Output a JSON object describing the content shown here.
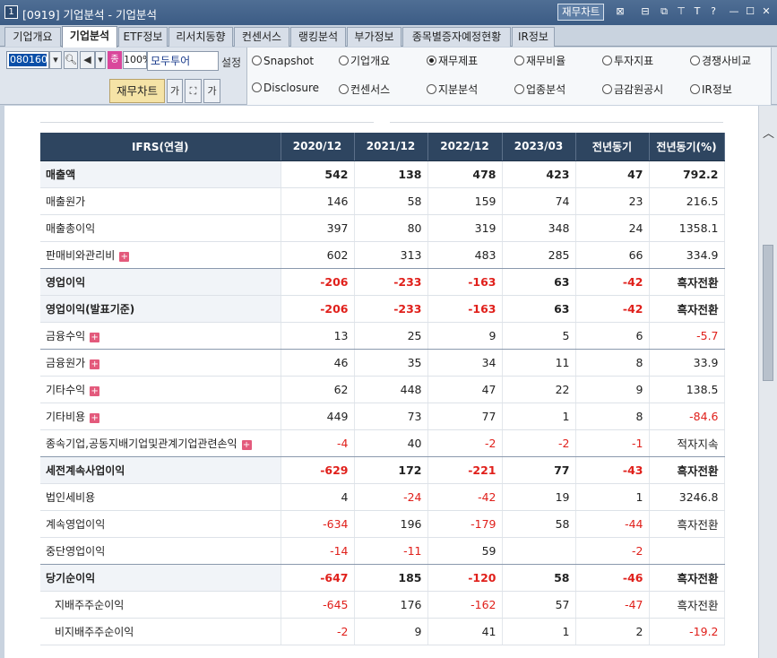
{
  "window": {
    "number": "1",
    "title": "[0919] 기업분석 - 기업분석",
    "chart_button": "재무차트"
  },
  "tabs": [
    {
      "label": "기업개요"
    },
    {
      "label": "기업분석"
    },
    {
      "label": "ETF정보"
    },
    {
      "label": "리서치동향"
    },
    {
      "label": "컨센서스"
    },
    {
      "label": "랭킹분석"
    },
    {
      "label": "부가정보"
    },
    {
      "label": "종목별증자예정현황"
    },
    {
      "label": "IR정보"
    }
  ],
  "toolbar": {
    "code": "080160",
    "zoom": "100%",
    "stock_name": "모두투어",
    "setting_label": "설정",
    "pink_label": "종",
    "fin_chart": "재무차트",
    "font_up": "가",
    "font_down": "가"
  },
  "radio_options": [
    {
      "label": "Snapshot",
      "checked": false
    },
    {
      "label": "기업개요",
      "checked": false
    },
    {
      "label": "재무제표",
      "checked": true
    },
    {
      "label": "재무비율",
      "checked": false
    },
    {
      "label": "투자지표",
      "checked": false
    },
    {
      "label": "경쟁사비교",
      "checked": false
    },
    {
      "label": "Disclosure",
      "checked": false
    },
    {
      "label": "컨센서스",
      "checked": false
    },
    {
      "label": "지분분석",
      "checked": false
    },
    {
      "label": "업종분석",
      "checked": false
    },
    {
      "label": "금감원공시",
      "checked": false
    },
    {
      "label": "IR정보",
      "checked": false
    }
  ],
  "table": {
    "headers": [
      "IFRS(연결)",
      "2020/12",
      "2021/12",
      "2022/12",
      "2023/03",
      "전년동기",
      "전년동기(%)"
    ],
    "rows": [
      {
        "label": "매출액",
        "values": [
          "542",
          "138",
          "478",
          "423",
          "47",
          "792.2"
        ],
        "bold": true,
        "hl": true
      },
      {
        "label": "매출원가",
        "values": [
          "146",
          "58",
          "159",
          "74",
          "23",
          "216.5"
        ]
      },
      {
        "label": "매출총이익",
        "values": [
          "397",
          "80",
          "319",
          "348",
          "24",
          "1358.1"
        ]
      },
      {
        "label": "판매비와관리비",
        "values": [
          "602",
          "313",
          "483",
          "285",
          "66",
          "334.9"
        ],
        "plus": true,
        "sep": true
      },
      {
        "label": "영업이익",
        "values": [
          "-206",
          "-233",
          "-163",
          "63",
          "-42",
          "흑자전환"
        ],
        "bold": true,
        "hl": true
      },
      {
        "label": "영업이익(발표기준)",
        "values": [
          "-206",
          "-233",
          "-163",
          "63",
          "-42",
          "흑자전환"
        ],
        "bold": true,
        "hl": true
      },
      {
        "label": "금융수익",
        "values": [
          "13",
          "25",
          "9",
          "5",
          "6",
          "-5.7"
        ],
        "plus": true,
        "sep": true
      },
      {
        "label": "금융원가",
        "values": [
          "46",
          "35",
          "34",
          "11",
          "8",
          "33.9"
        ],
        "plus": true
      },
      {
        "label": "기타수익",
        "values": [
          "62",
          "448",
          "47",
          "22",
          "9",
          "138.5"
        ],
        "plus": true
      },
      {
        "label": "기타비용",
        "values": [
          "449",
          "73",
          "77",
          "1",
          "8",
          "-84.6"
        ],
        "plus": true
      },
      {
        "label": "종속기업,공동지배기업및관계기업관련손익",
        "values": [
          "-4",
          "40",
          "-2",
          "-2",
          "-1",
          "적자지속"
        ],
        "plus": true,
        "sep": true
      },
      {
        "label": "세전계속사업이익",
        "values": [
          "-629",
          "172",
          "-221",
          "77",
          "-43",
          "흑자전환"
        ],
        "bold": true,
        "hl": true
      },
      {
        "label": "법인세비용",
        "values": [
          "4",
          "-24",
          "-42",
          "19",
          "1",
          "3246.8"
        ]
      },
      {
        "label": "계속영업이익",
        "values": [
          "-634",
          "196",
          "-179",
          "58",
          "-44",
          "흑자전환"
        ]
      },
      {
        "label": "중단영업이익",
        "values": [
          "-14",
          "-11",
          "59",
          "",
          "-2",
          ""
        ],
        "sep": true
      },
      {
        "label": "당기순이익",
        "values": [
          "-647",
          "185",
          "-120",
          "58",
          "-46",
          "흑자전환"
        ],
        "bold": true,
        "hl": true
      },
      {
        "label": "지배주주순이익",
        "values": [
          "-645",
          "176",
          "-162",
          "57",
          "-47",
          "흑자전환"
        ],
        "sub": true
      },
      {
        "label": "비지배주주순이익",
        "values": [
          "-2",
          "9",
          "41",
          "1",
          "2",
          "-19.2"
        ],
        "sub": true
      }
    ]
  }
}
